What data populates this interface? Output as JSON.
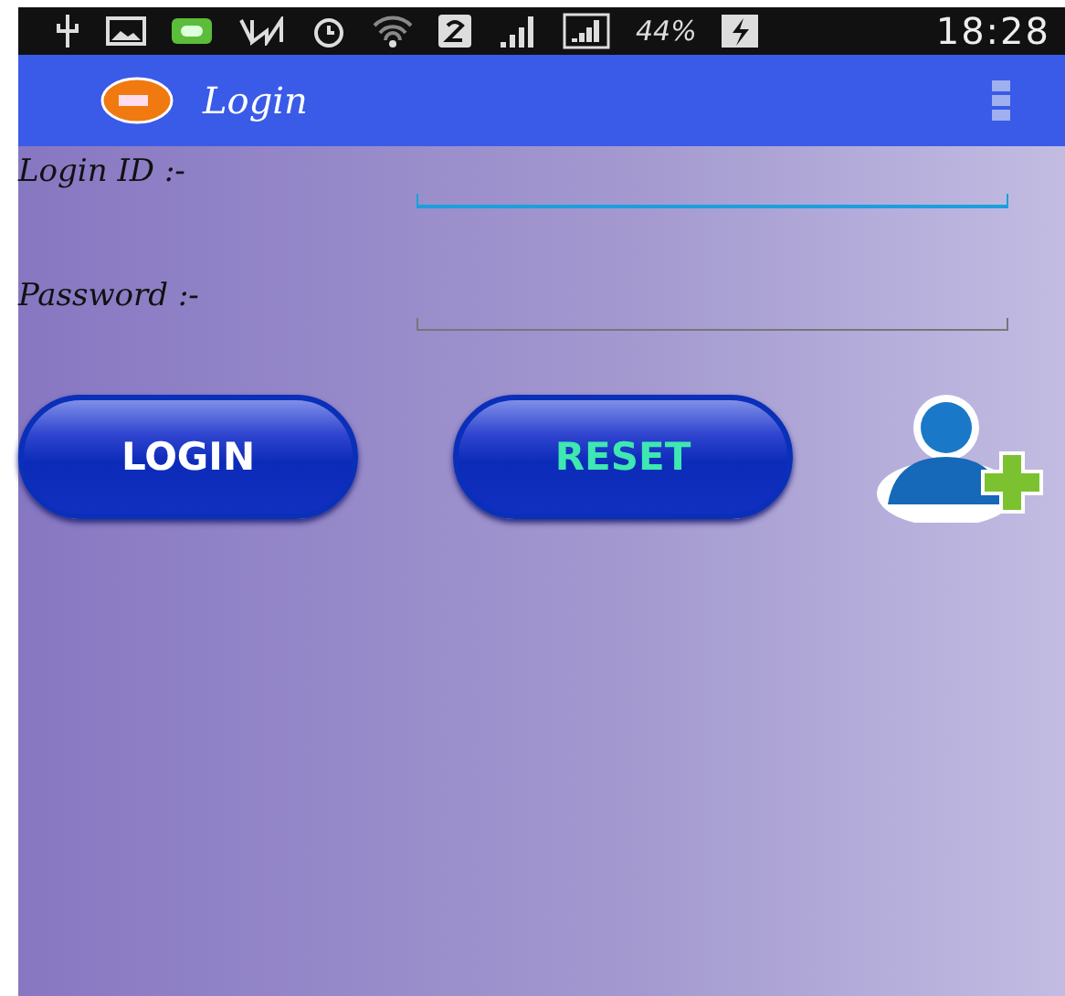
{
  "status_bar": {
    "battery": "44%",
    "time": "18:28"
  },
  "app_bar": {
    "title": "Login"
  },
  "fields": [
    {
      "label": "Login ID :-",
      "focused": true
    },
    {
      "label": "Password :-",
      "focused": false
    }
  ],
  "buttons": [
    {
      "label": "LOGIN",
      "kind": "login"
    },
    {
      "label": "RESET",
      "kind": "reset"
    }
  ]
}
